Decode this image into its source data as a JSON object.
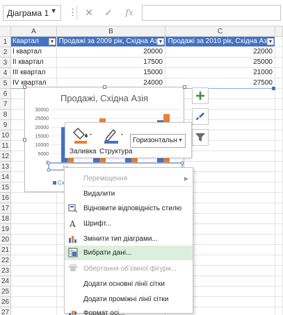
{
  "formula_bar": {
    "name_box": "Діаграма 1",
    "more": "⋮",
    "cancel": "✕",
    "enter": "✓",
    "fx": "fx",
    "formula": ""
  },
  "columns": [
    "A",
    "B",
    "C"
  ],
  "rows": [
    "1",
    "2",
    "3",
    "4",
    "5",
    "6",
    "7",
    "8",
    "9",
    "10",
    "11",
    "12",
    "13",
    "14",
    "15",
    "16",
    "17",
    "18",
    "19",
    "20",
    "21",
    "22",
    "23",
    "24",
    "25",
    "26",
    "27",
    "28"
  ],
  "table": {
    "headers": [
      "Квартал",
      "Продажі за 2009 рік, Східна Азія",
      "Продажі за 2010 рік, Східна Азія"
    ],
    "data": [
      [
        "I квартал",
        "20000",
        "22000"
      ],
      [
        "II квартал",
        "17500",
        "25000"
      ],
      [
        "III квартал",
        "15000",
        "21000"
      ],
      [
        "IV квартал",
        "24000",
        "27500"
      ]
    ]
  },
  "chart": {
    "title": "Продажі, Східна Азія",
    "y_ticks": [
      "30000",
      "25000",
      "20000",
      "15000",
      "10000",
      "5000",
      "0"
    ],
    "x_label_fragment": "I к",
    "legend_fragment": "Схі",
    "colors": {
      "series2009": "#4472c4",
      "series2010": "#ed7d31",
      "handle_blue": "#4472c4"
    }
  },
  "chart_data": {
    "type": "bar",
    "title": "Продажі, Східна Азія",
    "categories": [
      "I квартал",
      "II квартал",
      "III квартал",
      "IV квартал"
    ],
    "series": [
      {
        "name": "Продажі за 2009 рік, Східна Азія",
        "values": [
          20000,
          17500,
          15000,
          24000
        ]
      },
      {
        "name": "Продажі за 2010 рік, Східна Азія",
        "values": [
          22000,
          25000,
          21000,
          27500
        ]
      }
    ],
    "ylim": [
      0,
      30000
    ]
  },
  "side_buttons": [
    {
      "name": "chart-elements-button",
      "icon": "plus-icon"
    },
    {
      "name": "chart-styles-button",
      "icon": "brush-icon"
    },
    {
      "name": "chart-filters-button",
      "icon": "filter-icon"
    }
  ],
  "mini_toolbar": {
    "fill_label": "Заливка",
    "outline_label": "Структура",
    "element_select": "Горизонтальн",
    "fill_color": "#ed7d31",
    "outline_color": "#4472c4"
  },
  "context_menu": {
    "items": [
      {
        "label": "Переміщення",
        "disabled": true,
        "submenu": true,
        "icon": ""
      },
      {
        "label": "Видалити",
        "disabled": false,
        "icon": ""
      },
      {
        "label": "Відновити відповідність стилю",
        "disabled": false,
        "icon": "reset-style-icon"
      },
      {
        "label": "Шрифт...",
        "disabled": false,
        "icon": "font-icon"
      },
      {
        "label": "Змінити тип діаграми...",
        "disabled": false,
        "icon": "chart-type-icon"
      },
      {
        "label": "Вибрати дані...",
        "disabled": false,
        "hover": true,
        "icon": "select-data-icon"
      },
      {
        "label": "Обертання об’ємної фігури...",
        "disabled": true,
        "icon": "rotate-3d-icon"
      },
      {
        "label": "Додати основні лінії сітки",
        "disabled": false,
        "icon": ""
      },
      {
        "label": "Додати проміжні лінії сітки",
        "disabled": false,
        "icon": ""
      },
      {
        "label": "Формат осі...",
        "disabled": false,
        "icon": "format-axis-icon"
      }
    ]
  }
}
